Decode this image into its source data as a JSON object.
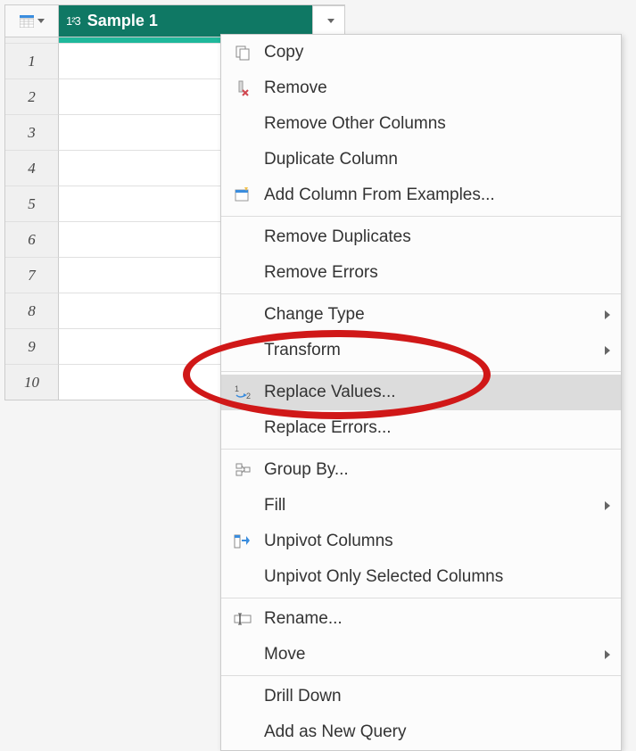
{
  "column": {
    "type_icon_text": "1²3",
    "name": "Sample 1"
  },
  "rows": [
    "1",
    "2",
    "3",
    "4",
    "5",
    "6",
    "7",
    "8",
    "9",
    "10"
  ],
  "menu": {
    "copy": "Copy",
    "remove": "Remove",
    "remove_other": "Remove Other Columns",
    "duplicate": "Duplicate Column",
    "add_from_examples": "Add Column From Examples...",
    "remove_duplicates": "Remove Duplicates",
    "remove_errors": "Remove Errors",
    "change_type": "Change Type",
    "transform": "Transform",
    "replace_values": "Replace Values...",
    "replace_errors": "Replace Errors...",
    "group_by": "Group By...",
    "fill": "Fill",
    "unpivot": "Unpivot Columns",
    "unpivot_only": "Unpivot Only Selected Columns",
    "rename": "Rename...",
    "move": "Move",
    "drill_down": "Drill Down",
    "add_as_new_query": "Add as New Query"
  },
  "icons": {
    "replace_prefix": "1",
    "replace_suffix": "2"
  }
}
